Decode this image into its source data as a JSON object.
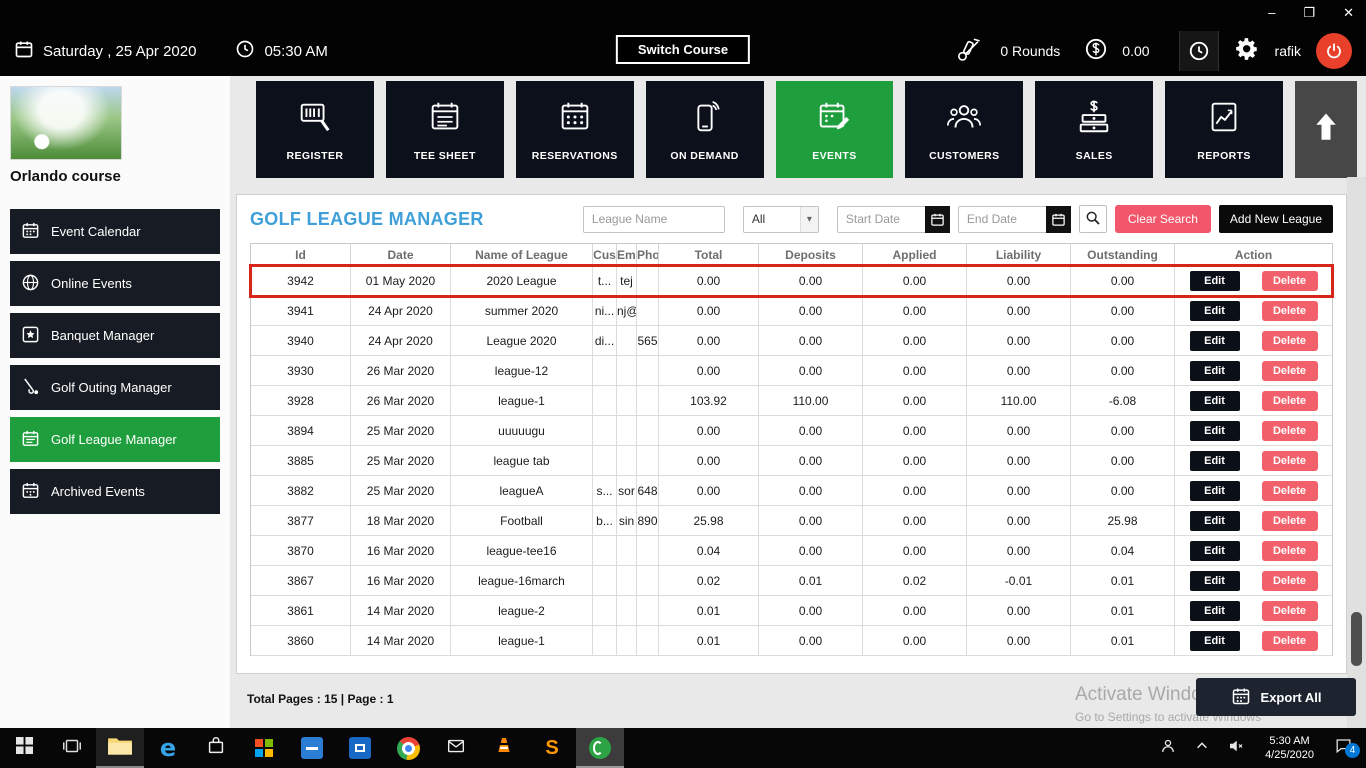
{
  "colors": {
    "accent_green": "#1e9e3c",
    "danger_red": "#f2566b",
    "title_blue": "#3f9fd8",
    "power_red": "#e8402a",
    "tile_dark": "#0b101b"
  },
  "window_controls": {
    "minimize": "–",
    "restore": "❐",
    "close": "✕"
  },
  "header": {
    "date": "Saturday ,  25 Apr 2020",
    "time": "05:30 AM",
    "switch_course_label": "Switch Course",
    "rounds_label": "0 Rounds",
    "balance": "0.00",
    "user_name": "rafik"
  },
  "course_name": "Orlando course",
  "nav_tiles": [
    {
      "label": "REGISTER",
      "icon": "barcode-scanner-icon",
      "active": false
    },
    {
      "label": "TEE SHEET",
      "icon": "tee-sheet-icon",
      "active": false
    },
    {
      "label": "RESERVATIONS",
      "icon": "reservations-calendar-icon",
      "active": false
    },
    {
      "label": "ON DEMAND",
      "icon": "mobile-icon",
      "active": false
    },
    {
      "label": "EVENTS",
      "icon": "events-calendar-pencil-icon",
      "active": true
    },
    {
      "label": "CUSTOMERS",
      "icon": "customers-icon",
      "active": false
    },
    {
      "label": "SALES",
      "icon": "sales-money-icon",
      "active": false
    },
    {
      "label": "REPORTS",
      "icon": "reports-chart-icon",
      "active": false
    }
  ],
  "sidebar": {
    "items": [
      {
        "label": "Event Calendar",
        "active": false
      },
      {
        "label": "Online Events",
        "active": false
      },
      {
        "label": "Banquet Manager",
        "active": false
      },
      {
        "label": "Golf Outing Manager",
        "active": false
      },
      {
        "label": "Golf League Manager",
        "active": true
      },
      {
        "label": "Archived Events",
        "active": false
      }
    ]
  },
  "main": {
    "title": "GOLF LEAGUE MANAGER",
    "search": {
      "league_name_placeholder": "League Name",
      "type_filter_value": "All",
      "start_date_placeholder": "Start Date",
      "end_date_placeholder": "End Date",
      "clear_search_label": "Clear Search",
      "add_new_league_label": "Add New League"
    },
    "table": {
      "columns": [
        "Id",
        "Date",
        "Name of League",
        "Cus",
        "Ema",
        "Pho",
        "Total",
        "Deposits",
        "Applied",
        "Liability",
        "Outstanding",
        "Action"
      ],
      "edit_label": "Edit",
      "delete_label": "Delete",
      "rows": [
        {
          "id": "3942",
          "date": "01 May 2020",
          "name": "2020 League",
          "cus": "t...",
          "ema": "tej",
          "pho": "",
          "total": "0.00",
          "deposits": "0.00",
          "applied": "0.00",
          "liability": "0.00",
          "outstanding": "0.00",
          "highlighted": true
        },
        {
          "id": "3941",
          "date": "24 Apr 2020",
          "name": "summer 2020",
          "cus": "ni...",
          "ema": "nj@",
          "pho": "",
          "total": "0.00",
          "deposits": "0.00",
          "applied": "0.00",
          "liability": "0.00",
          "outstanding": "0.00"
        },
        {
          "id": "3940",
          "date": "24 Apr 2020",
          "name": "League 2020",
          "cus": "di...",
          "ema": "",
          "pho": "565",
          "total": "0.00",
          "deposits": "0.00",
          "applied": "0.00",
          "liability": "0.00",
          "outstanding": "0.00"
        },
        {
          "id": "3930",
          "date": "26 Mar 2020",
          "name": "league-12",
          "cus": "",
          "ema": "",
          "pho": "",
          "total": "0.00",
          "deposits": "0.00",
          "applied": "0.00",
          "liability": "0.00",
          "outstanding": "0.00"
        },
        {
          "id": "3928",
          "date": "26 Mar 2020",
          "name": "league-1",
          "cus": "",
          "ema": "",
          "pho": "",
          "total": "103.92",
          "deposits": "110.00",
          "applied": "0.00",
          "liability": "110.00",
          "outstanding": "-6.08"
        },
        {
          "id": "3894",
          "date": "25 Mar 2020",
          "name": "uuuuugu",
          "cus": "",
          "ema": "",
          "pho": "",
          "total": "0.00",
          "deposits": "0.00",
          "applied": "0.00",
          "liability": "0.00",
          "outstanding": "0.00"
        },
        {
          "id": "3885",
          "date": "25 Mar 2020",
          "name": "league tab",
          "cus": "",
          "ema": "",
          "pho": "",
          "total": "0.00",
          "deposits": "0.00",
          "applied": "0.00",
          "liability": "0.00",
          "outstanding": "0.00"
        },
        {
          "id": "3882",
          "date": "25 Mar 2020",
          "name": "leagueA",
          "cus": "s...",
          "ema": "sor",
          "pho": "648",
          "total": "0.00",
          "deposits": "0.00",
          "applied": "0.00",
          "liability": "0.00",
          "outstanding": "0.00"
        },
        {
          "id": "3877",
          "date": "18 Mar 2020",
          "name": "Football",
          "cus": "b...",
          "ema": "sin",
          "pho": "890",
          "total": "25.98",
          "deposits": "0.00",
          "applied": "0.00",
          "liability": "0.00",
          "outstanding": "25.98"
        },
        {
          "id": "3870",
          "date": "16 Mar 2020",
          "name": "league-tee16",
          "cus": "",
          "ema": "",
          "pho": "",
          "total": "0.04",
          "deposits": "0.00",
          "applied": "0.00",
          "liability": "0.00",
          "outstanding": "0.04"
        },
        {
          "id": "3867",
          "date": "16 Mar 2020",
          "name": "league-16march",
          "cus": "",
          "ema": "",
          "pho": "",
          "total": "0.02",
          "deposits": "0.01",
          "applied": "0.02",
          "liability": "-0.01",
          "outstanding": "0.01"
        },
        {
          "id": "3861",
          "date": "14 Mar 2020",
          "name": "league-2",
          "cus": "",
          "ema": "",
          "pho": "",
          "total": "0.01",
          "deposits": "0.00",
          "applied": "0.00",
          "liability": "0.00",
          "outstanding": "0.01"
        },
        {
          "id": "3860",
          "date": "14 Mar 2020",
          "name": "league-1",
          "cus": "",
          "ema": "",
          "pho": "",
          "total": "0.01",
          "deposits": "0.00",
          "applied": "0.00",
          "liability": "0.00",
          "outstanding": "0.01"
        }
      ]
    },
    "footer": {
      "total_pages_label": "Total Pages : 15 | Page : 1",
      "export_all_label": "Export All"
    }
  },
  "watermark": {
    "line1": "Activate Windows",
    "line2": "Go to Settings to activate Windows"
  },
  "taskbar": {
    "tray_time": "5:30 AM",
    "tray_date": "4/25/2020",
    "notification_count": "4"
  }
}
